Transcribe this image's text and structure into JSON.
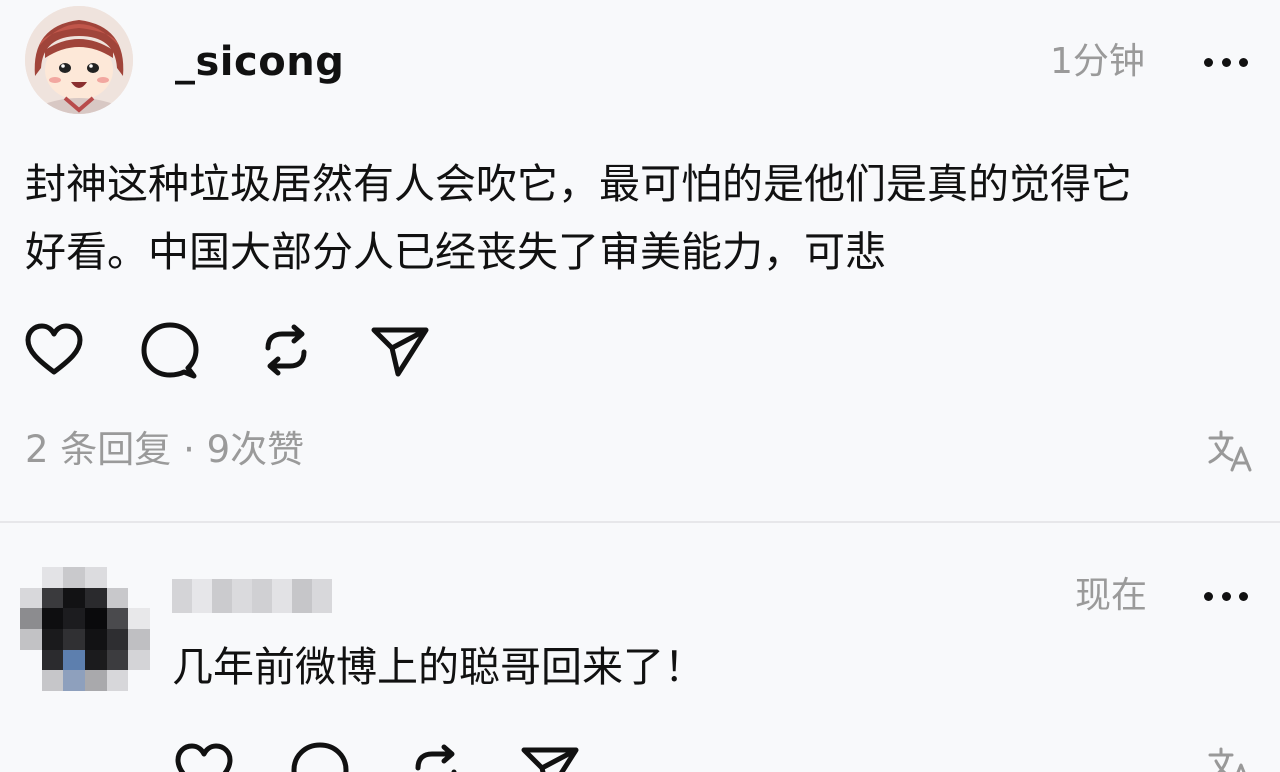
{
  "post": {
    "username": "_sicong",
    "time": "1分钟",
    "text_line1": "封神这种垃圾居然有人会吹它，最可怕的是他们是真的觉得它",
    "text_line2": "好看。中国大部分人已经丧失了审美能力，可悲",
    "stats": "2 条回复 · 9次赞",
    "icons": [
      "heart-icon",
      "comment-icon",
      "repost-icon",
      "share-icon",
      "translate-icon",
      "more-icon"
    ]
  },
  "reply": {
    "time": "现在",
    "text": "几年前微博上的聪哥回来了！",
    "icons": [
      "heart-icon",
      "comment-icon",
      "repost-icon",
      "share-icon",
      "translate-icon",
      "more-icon"
    ]
  },
  "colors": {
    "background": "#f8f9fb",
    "text": "#111111",
    "muted": "#9a9a9a",
    "divider": "#e7e7ea"
  }
}
